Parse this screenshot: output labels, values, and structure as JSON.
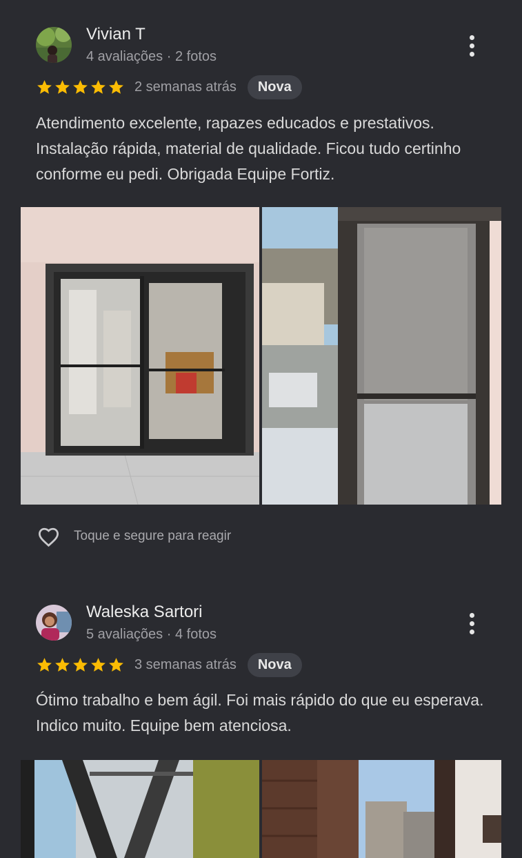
{
  "reviews": [
    {
      "author": "Vivian T",
      "meta": "4 avaliações · 2 fotos",
      "rating": 5,
      "time": "2 semanas atrás",
      "badge": "Nova",
      "text": "Atendimento excelente, rapazes educados e prestativos. Instalação rápida, material de qualidade. Ficou tudo certinho conforme eu pedi. Obrigada Equipe Fortiz.",
      "react_label": "Toque e segure para reagir"
    },
    {
      "author": "Waleska Sartori",
      "meta": "5 avaliações · 4 fotos",
      "rating": 5,
      "time": "3 semanas atrás",
      "badge": "Nova",
      "text": "Ótimo trabalho e bem ágil. Foi mais rápido do que eu esperava. Indico muito. Equipe bem atenciosa."
    }
  ],
  "colors": {
    "background": "#2a2b30",
    "star": "#fbbc04",
    "badge_bg": "#3f4148"
  },
  "icons": [
    "more-vert-icon",
    "star-icon",
    "heart-outline-icon"
  ]
}
